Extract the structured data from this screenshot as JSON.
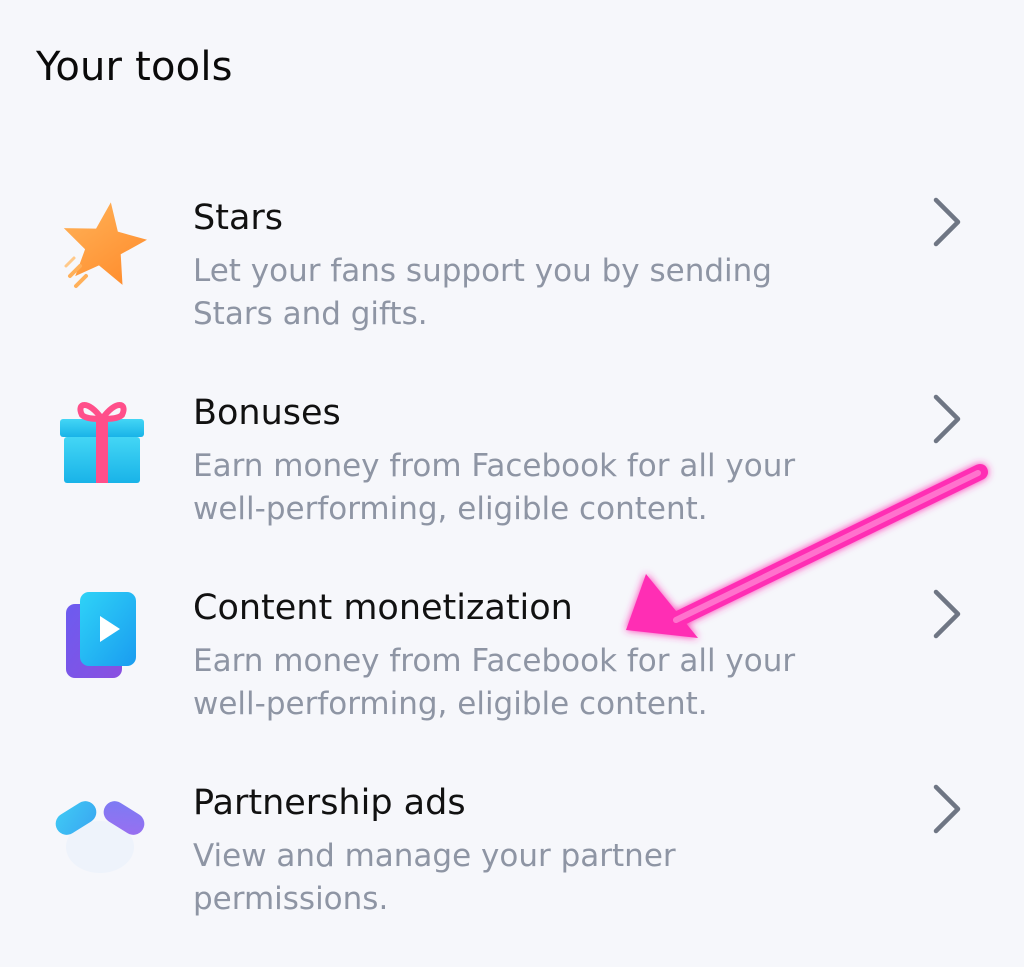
{
  "header": {
    "title": "Your tools"
  },
  "tools": [
    {
      "title": "Stars",
      "description": "Let your fans support you by sending Stars and gifts.",
      "icon": "star-icon"
    },
    {
      "title": "Bonuses",
      "description": "Earn money from Facebook for all your well-performing,  eligible content.",
      "icon": "gift-icon"
    },
    {
      "title": "Content monetization",
      "description": "Earn money from Facebook for all your well-performing,  eligible content.",
      "icon": "play-video-icon"
    },
    {
      "title": "Partnership ads",
      "description": "View and manage your partner permissions.",
      "icon": "handshake-icon"
    }
  ],
  "colors": {
    "background": "#f6f7fb",
    "title_text": "#111111",
    "description_text": "#8e95a4",
    "chevron": "#6f7684",
    "annotation_arrow": "#ff2fb4"
  }
}
